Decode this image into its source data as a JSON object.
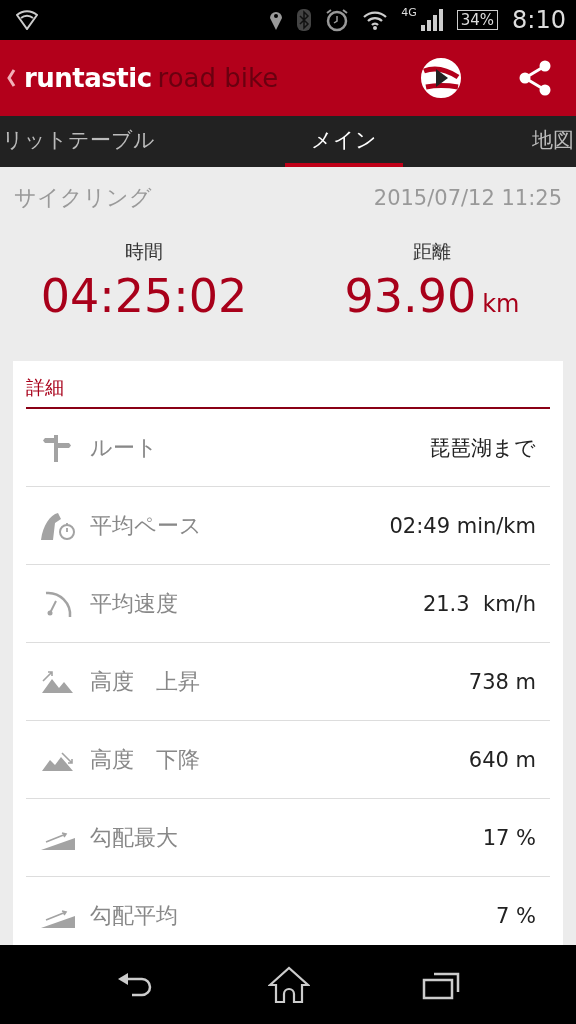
{
  "status_bar": {
    "network": "4G",
    "battery": "34%",
    "time": "8:10"
  },
  "app_bar": {
    "brand": "runtastic",
    "product": "road bike"
  },
  "tabs": [
    {
      "label": "リットテーブル",
      "selected": false
    },
    {
      "label": "メイン",
      "selected": true
    },
    {
      "label": "地図",
      "selected": false
    }
  ],
  "activity": {
    "type": "サイクリング",
    "date": "2015/07/12 11:25"
  },
  "stats": [
    {
      "label": "時間",
      "value": "04:25:02"
    },
    {
      "label": "距離",
      "value": "93.90",
      "unit": "km"
    }
  ],
  "details": {
    "title": "詳細",
    "rows": [
      {
        "kind": "route",
        "label": "ルート",
        "value": "琵琶湖まで"
      },
      {
        "kind": "pace",
        "label": "平均ペース",
        "value": "02:49 min/km"
      },
      {
        "kind": "speed",
        "label": "平均速度",
        "value": "21.3  km/h"
      },
      {
        "kind": "ascent",
        "label": "高度　上昇",
        "value": "738 m"
      },
      {
        "kind": "descent",
        "label": "高度　下降",
        "value": "640 m"
      },
      {
        "kind": "grade",
        "label": "勾配最大",
        "value": "17 %"
      },
      {
        "kind": "grade",
        "label": "勾配平均",
        "value": "7 %"
      }
    ]
  }
}
